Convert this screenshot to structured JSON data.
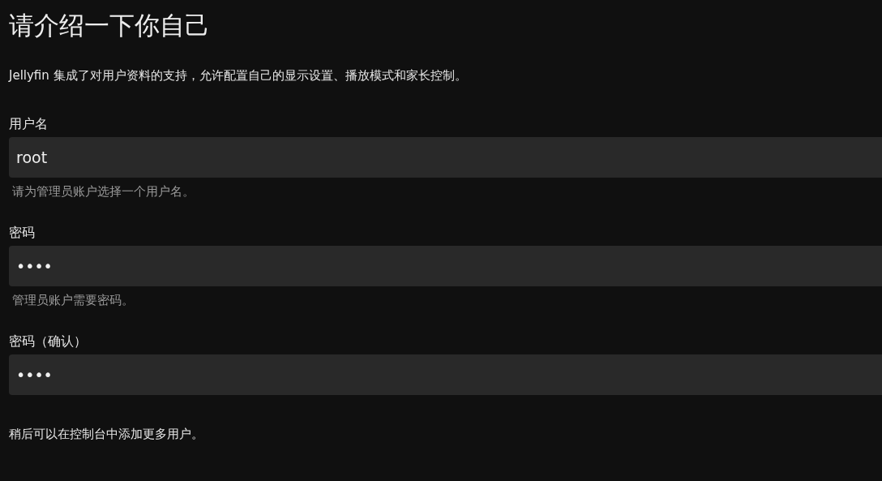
{
  "title": "请介绍一下你自己",
  "description": "Jellyfin 集成了对用户资料的支持，允许配置自己的显示设置、播放模式和家长控制。",
  "fields": [
    {
      "label": "用户名",
      "value": "root",
      "help": "请为管理员账户选择一个用户名。"
    },
    {
      "label": "密码",
      "value": "••••",
      "help": "管理员账户需要密码。"
    },
    {
      "label": "密码（确认）",
      "value": "••••"
    }
  ],
  "footer": "稍后可以在控制台中添加更多用户。"
}
